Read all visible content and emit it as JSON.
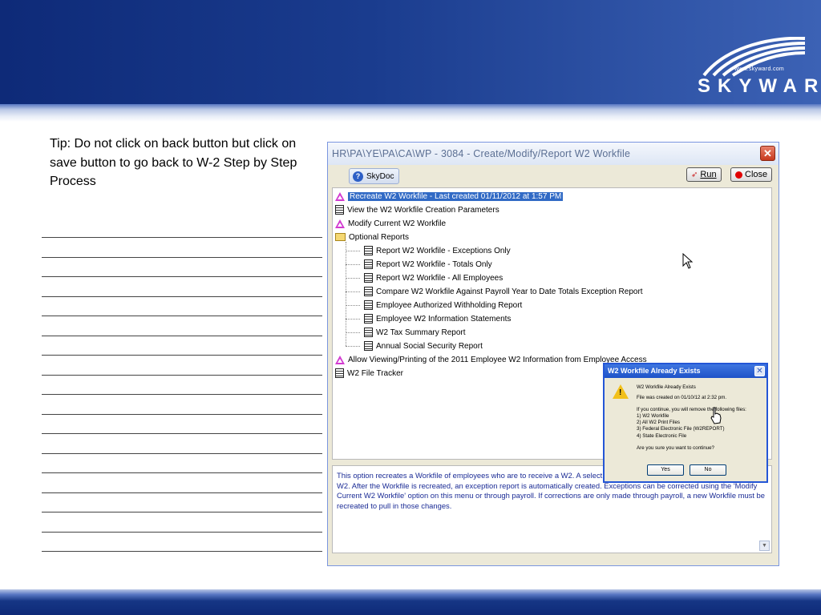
{
  "brand": {
    "url": "www.skyward.com",
    "name": "SKYWARD",
    "reg": "®"
  },
  "tip": "Tip: Do not click on back button but click on save button to go back to W-2 Step by Step Process",
  "window": {
    "title": "HR\\PA\\YE\\PA\\CA\\WP - 3084 - Create/Modify/Report W2 Workfile",
    "close_glyph": "✕",
    "toolbar": {
      "skydoc": "SkyDoc",
      "run": "Run",
      "close": "Close"
    },
    "tree": [
      {
        "label": "Recreate W2 Workfile - Last created 01/11/2012 at  1:57 PM",
        "icon": "triangle-icon",
        "selected": true
      },
      {
        "label": "View the W2 Workfile Creation Parameters",
        "icon": "document-icon"
      },
      {
        "label": "Modify Current W2 Workfile",
        "icon": "triangle-icon"
      },
      {
        "label": "Optional Reports",
        "icon": "folder-icon"
      },
      {
        "label": "Report W2 Workfile - Exceptions Only",
        "icon": "document-icon",
        "child": true
      },
      {
        "label": "Report W2 Workfile - Totals Only",
        "icon": "document-icon",
        "child": true
      },
      {
        "label": "Report W2 Workfile - All Employees",
        "icon": "document-icon",
        "child": true
      },
      {
        "label": "Compare W2 Workfile Against Payroll Year to Date Totals Exception Report",
        "icon": "document-icon",
        "child": true
      },
      {
        "label": "Employee Authorized Withholding Report",
        "icon": "document-icon",
        "child": true
      },
      {
        "label": "Employee W2 Information Statements",
        "icon": "document-icon",
        "child": true
      },
      {
        "label": "W2 Tax Summary Report",
        "icon": "document-icon",
        "child": true
      },
      {
        "label": "Annual Social Security Report",
        "icon": "document-icon",
        "child": true
      },
      {
        "label": "Allow Viewing/Printing of the 2011 Employee W2 Information from Employee Access",
        "icon": "triangle-icon"
      },
      {
        "label": "W2 File Tracker",
        "icon": "document-icon"
      }
    ],
    "description": "This option recreates a Workfile of employees who are to receive a W2.  A select deductions and benefits to be included on the W2.  After the Workfile is recreated, an exception report is automatically created.  Exceptions can be corrected using the 'Modify Current W2 Workfile' option on this menu or through payroll.  If corrections are only made through payroll, a new Workfile must be recreated to pull in those changes."
  },
  "dialog": {
    "title": "W2 Workfile Already Exists",
    "close_glyph": "✕",
    "heading": "W2 Workfile Already Exists",
    "created": "File was created on 01/10/12 at  2:32 pm.",
    "intro": "If you continue, you will remove the following files:",
    "files": [
      "1) W2 Workfile",
      "2) All W2 Print Files",
      "3) Federal Electronic File (W2REPORT)",
      "4) State Electronic File"
    ],
    "question": "Are you sure you want to continue?",
    "yes": "Yes",
    "no": "No"
  }
}
